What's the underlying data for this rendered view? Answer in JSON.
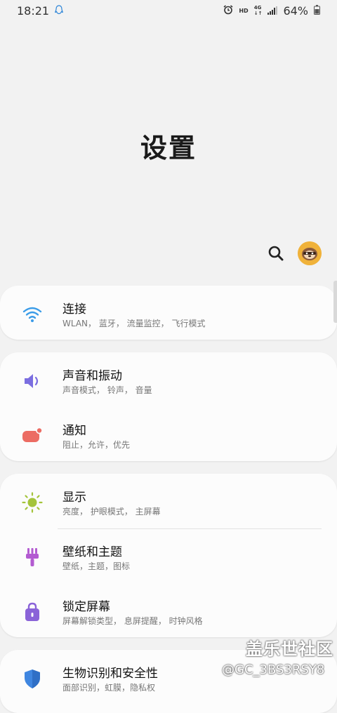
{
  "status_bar": {
    "time": "18:21",
    "hd": "HD",
    "network": "4G",
    "battery": "64%"
  },
  "title": "设置",
  "header": {
    "search_icon": "search-icon",
    "avatar_icon": "sloth-avatar"
  },
  "groups": [
    {
      "items": [
        {
          "label": "连接",
          "sub": "WLAN， 蓝牙， 流量监控， 飞行模式",
          "icon": "wifi-icon",
          "color": "#3b9ce8"
        }
      ]
    },
    {
      "items": [
        {
          "label": "声音和振动",
          "sub": "声音模式， 铃声， 音量",
          "icon": "sound-icon",
          "color": "#7b6ee0"
        },
        {
          "label": "通知",
          "sub": "阻止，允许，优先",
          "icon": "notification-icon",
          "color": "#ec6c63"
        }
      ]
    },
    {
      "items": [
        {
          "label": "显示",
          "sub": "亮度， 护眼模式， 主屏幕",
          "icon": "brightness-icon",
          "color": "#a4c43a"
        },
        {
          "label": "壁纸和主题",
          "sub": "壁纸，主题，图标",
          "icon": "brush-icon",
          "color": "#b35bd1"
        },
        {
          "label": "锁定屏幕",
          "sub": "屏幕解锁类型， 息屏提醒， 时钟风格",
          "icon": "lock-icon",
          "color": "#8a63d8"
        }
      ]
    },
    {
      "items": [
        {
          "label": "生物识别和安全性",
          "sub": "面部识别，虹膜，隐私权",
          "icon": "shield-icon",
          "color": "#3f86e0"
        }
      ]
    }
  ],
  "watermark": {
    "line1": "盖乐世社区",
    "line2": "@GC_3BS3RSY8"
  }
}
